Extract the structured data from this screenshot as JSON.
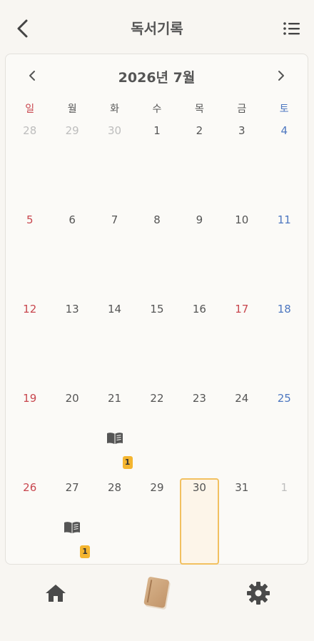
{
  "header": {
    "title": "독서기록"
  },
  "calendar": {
    "month_label": "2026년 7월",
    "weekdays": [
      "일",
      "월",
      "화",
      "수",
      "목",
      "금",
      "토"
    ],
    "weeks": [
      [
        {
          "day": "28",
          "muted": true
        },
        {
          "day": "29",
          "muted": true
        },
        {
          "day": "30",
          "muted": true
        },
        {
          "day": "1"
        },
        {
          "day": "2"
        },
        {
          "day": "3"
        },
        {
          "day": "4"
        }
      ],
      [
        {
          "day": "5"
        },
        {
          "day": "6"
        },
        {
          "day": "7"
        },
        {
          "day": "8"
        },
        {
          "day": "9"
        },
        {
          "day": "10"
        },
        {
          "day": "11"
        }
      ],
      [
        {
          "day": "12"
        },
        {
          "day": "13"
        },
        {
          "day": "14"
        },
        {
          "day": "15"
        },
        {
          "day": "16"
        },
        {
          "day": "17",
          "holiday": true
        },
        {
          "day": "18"
        }
      ],
      [
        {
          "day": "19"
        },
        {
          "day": "20"
        },
        {
          "day": "21",
          "count": "1"
        },
        {
          "day": "22"
        },
        {
          "day": "23"
        },
        {
          "day": "24"
        },
        {
          "day": "25"
        }
      ],
      [
        {
          "day": "26"
        },
        {
          "day": "27",
          "count": "1"
        },
        {
          "day": "28"
        },
        {
          "day": "29"
        },
        {
          "day": "30",
          "today": true
        },
        {
          "day": "31"
        },
        {
          "day": "1",
          "muted": true
        }
      ]
    ]
  },
  "colors": {
    "sunday": "#c8464e",
    "saturday": "#4d77c0",
    "muted": "#bdbdbd",
    "badge": "#f4b530",
    "today_border": "#f2c060"
  },
  "icons": [
    "back-icon",
    "list-icon",
    "chevron-left-icon",
    "chevron-right-icon",
    "open-book-icon",
    "home-icon",
    "book-icon",
    "gear-icon"
  ]
}
